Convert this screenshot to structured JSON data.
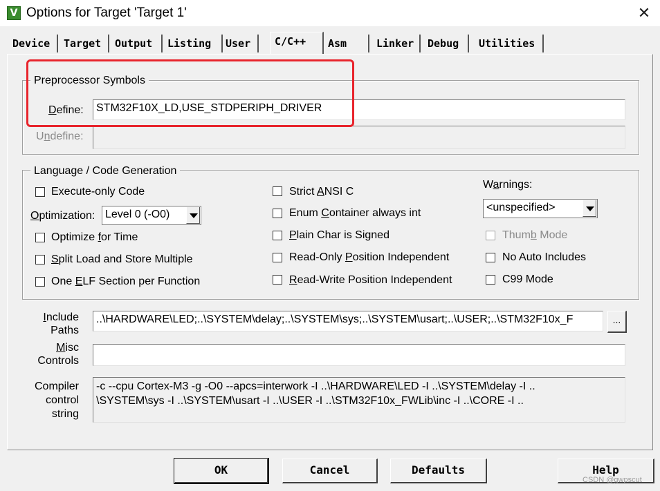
{
  "window": {
    "title": "Options for Target 'Target 1'",
    "close_glyph": "✕",
    "icon_glyph": "V",
    "icon": "uvision-app-icon"
  },
  "tabs": [
    {
      "label": "Device"
    },
    {
      "label": "Target"
    },
    {
      "label": "Output"
    },
    {
      "label": "Listing"
    },
    {
      "label": "User"
    },
    {
      "label": "C/C++",
      "active": true
    },
    {
      "label": "Asm"
    },
    {
      "label": "Linker"
    },
    {
      "label": "Debug"
    },
    {
      "label": "Utilities"
    }
  ],
  "preprocessor": {
    "title": "Preprocessor Symbols",
    "define_label_pre": "",
    "define_label_ul": "D",
    "define_label_post": "efine:",
    "define_value": "STM32F10X_LD,USE_STDPERIPH_DRIVER",
    "undefine_label_pre": "U",
    "undefine_label_ul": "n",
    "undefine_label_post": "define:",
    "undefine_value": ""
  },
  "language": {
    "title": "Language / Code Generation",
    "execute_only": {
      "label": "Execute-only Code",
      "checked": false
    },
    "optimization": {
      "label_pre": "",
      "label_ul": "O",
      "label_post": "ptimization:",
      "value": "Level 0 (-O0)"
    },
    "optimize_time": {
      "pre": "Optimize ",
      "ul": "f",
      "post": "or Time",
      "checked": false
    },
    "split_load": {
      "pre": "",
      "ul": "S",
      "post": "plit Load and Store Multiple",
      "checked": false
    },
    "one_elf": {
      "pre": "One ",
      "ul": "E",
      "post": "LF Section per Function",
      "checked": false
    },
    "strict_ansi": {
      "pre": "Strict ",
      "ul": "A",
      "post": "NSI C",
      "checked": false
    },
    "enum_container": {
      "pre": "Enum ",
      "ul": "C",
      "post": "ontainer always int",
      "checked": false
    },
    "plain_char": {
      "pre": "",
      "ul": "P",
      "post": "lain Char is Signed",
      "checked": false
    },
    "ro_position": {
      "pre": "Read-Only ",
      "ul": "P",
      "post": "osition Independent",
      "checked": false
    },
    "rw_position": {
      "pre": "",
      "ul": "R",
      "post": "ead-Write Position Independent",
      "checked": false
    },
    "warnings": {
      "label_pre": "W",
      "label_ul": "a",
      "label_post": "rnings:",
      "value": "<unspecified>"
    },
    "thumb_mode": {
      "pre": "Thum",
      "ul": "b",
      "post": " Mode",
      "checked": false,
      "disabled": true
    },
    "no_auto_includes": {
      "label": "No Auto Includes",
      "checked": false
    },
    "c99_mode": {
      "label": "C99 Mode",
      "checked": false
    }
  },
  "include_paths": {
    "label_line1_ul": "I",
    "label_line1_post": "nclude",
    "label_line2": "Paths",
    "value": "..\\HARDWARE\\LED;..\\SYSTEM\\delay;..\\SYSTEM\\sys;..\\SYSTEM\\usart;..\\USER;..\\STM32F10x_F",
    "browse_label": "..."
  },
  "misc_controls": {
    "label_line1_ul": "M",
    "label_line1_post": "isc",
    "label_line2": "Controls",
    "value": ""
  },
  "compiler_control": {
    "label_line1": "Compiler",
    "label_line2": "control",
    "label_line3": "string",
    "value": "-c --cpu Cortex-M3 -g -O0 --apcs=interwork -I ..\\HARDWARE\\LED -I ..\\SYSTEM\\delay -I ..\n\\SYSTEM\\sys -I ..\\SYSTEM\\usart -I ..\\USER -I ..\\STM32F10x_FWLib\\inc -I ..\\CORE -I .."
  },
  "buttons": {
    "ok": "OK",
    "cancel": "Cancel",
    "defaults": "Defaults",
    "help": "Help"
  },
  "watermark": "CSDN @gwpscut",
  "colors": {
    "highlight": "#e8242c",
    "dialog_bg": "#f0f0f0",
    "icon_green": "#3a8c2e"
  }
}
